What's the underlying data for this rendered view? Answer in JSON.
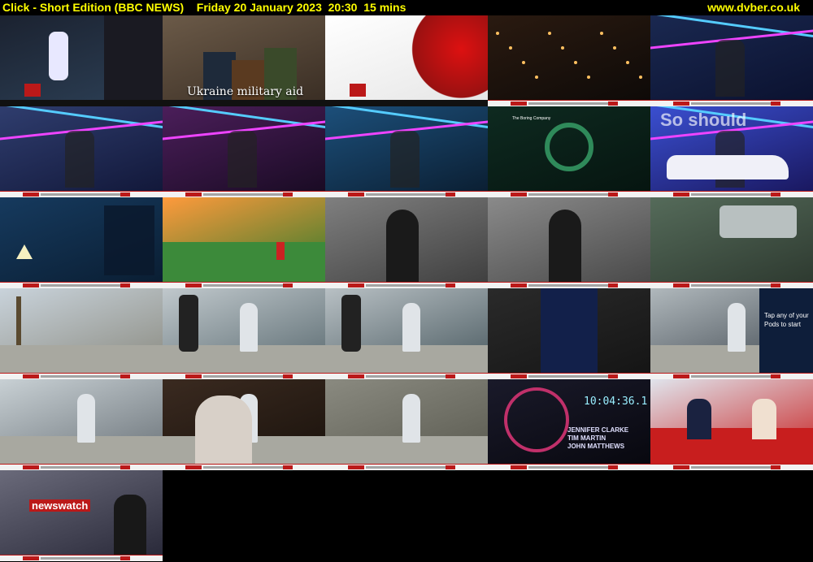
{
  "header": {
    "title": "Click - Short Edition (BBC NEWS)    Friday 20 January 2023  20:30  15 mins",
    "site": "www.dvber.co.uk"
  },
  "thumbnails": [
    {
      "id": 1,
      "scene": "motion-capture-software",
      "bg": [
        "#1b2230",
        "#2c3f55"
      ]
    },
    {
      "id": 2,
      "scene": "press-conference",
      "bg": [
        "#6b5a48",
        "#3a2e24"
      ],
      "caption": "Ukraine military aid"
    },
    {
      "id": 3,
      "scene": "bbc-news-ident",
      "bg": [
        "#ffffff",
        "#e6e6e6"
      ]
    },
    {
      "id": 4,
      "scene": "city-night-aerial",
      "bg": [
        "#2a1a10",
        "#0e0a08"
      ]
    },
    {
      "id": 5,
      "scene": "neon-tunnel-car",
      "bg": [
        "#1a2850",
        "#0b1230"
      ]
    },
    {
      "id": 6,
      "scene": "presenter-neon-tunnel",
      "bg": [
        "#2f3d6e",
        "#12183a"
      ]
    },
    {
      "id": 7,
      "scene": "neon-tunnel-crowd",
      "bg": [
        "#4b1e5a",
        "#1a0b24"
      ]
    },
    {
      "id": 8,
      "scene": "neon-tunnel-presenter-blue",
      "bg": [
        "#1c4f7a",
        "#0b1f33"
      ]
    },
    {
      "id": 9,
      "scene": "boring-company-tunnel",
      "bg": [
        "#0e2a20",
        "#061510"
      ]
    },
    {
      "id": 10,
      "scene": "car-neon-so-should",
      "bg": [
        "#3a4fd0",
        "#1a1860"
      ]
    },
    {
      "id": 11,
      "scene": "driver-practice-sim",
      "bg": [
        "#163a5e",
        "#0a1e33"
      ]
    },
    {
      "id": 12,
      "scene": "golf-course-sunset",
      "bg": [
        "#ff9a3c",
        "#2e7a2c"
      ]
    },
    {
      "id": 13,
      "scene": "man-stanford-hoodie",
      "bg": [
        "#7f7f7f",
        "#404040"
      ]
    },
    {
      "id": 14,
      "scene": "two-men-golf-range",
      "bg": [
        "#8a8a8a",
        "#4a4a4a"
      ]
    },
    {
      "id": 15,
      "scene": "golf-launch-monitor",
      "bg": [
        "#556b5a",
        "#2e3a30"
      ]
    },
    {
      "id": 16,
      "scene": "backyard-palm-trees",
      "bg": [
        "#c9d3db",
        "#8a8a80"
      ]
    },
    {
      "id": 17,
      "scene": "woman-punching-bag",
      "bg": [
        "#c0c8cc",
        "#5a6a70"
      ]
    },
    {
      "id": 18,
      "scene": "woman-phone-punching-bag",
      "bg": [
        "#b8c0c4",
        "#4a5a60"
      ]
    },
    {
      "id": 19,
      "scene": "app-screen-phone",
      "bg": [
        "#2a2a2a",
        "#151515"
      ]
    },
    {
      "id": 20,
      "scene": "woman-pods-text",
      "bg": [
        "#b0b8bc",
        "#404850"
      ],
      "podtext": "Tap any of your Pods to start"
    },
    {
      "id": 21,
      "scene": "woman-plank-pods",
      "bg": [
        "#c8d0d4",
        "#6a7278"
      ]
    },
    {
      "id": 22,
      "scene": "woman-sofa",
      "bg": [
        "#3a2a20",
        "#1a120c"
      ]
    },
    {
      "id": 23,
      "scene": "woman-crouching-patio",
      "bg": [
        "#8a8a80",
        "#5a5a50"
      ]
    },
    {
      "id": 24,
      "scene": "credits-names",
      "bg": [
        "#1a1a2a",
        "#08080f"
      ],
      "timer": "10:04:36.1",
      "names": [
        "JENNIFER CLARKE",
        "TIM MARTIN",
        "JOHN MATTHEWS"
      ]
    },
    {
      "id": 25,
      "scene": "breakfast-sofa-presenters",
      "bg": [
        "#e0e4ec",
        "#c82020"
      ]
    },
    {
      "id": 26,
      "scene": "newswatch-studio",
      "bg": [
        "#6a6a7a",
        "#2a2a3a"
      ],
      "label": "newswatch"
    }
  ]
}
